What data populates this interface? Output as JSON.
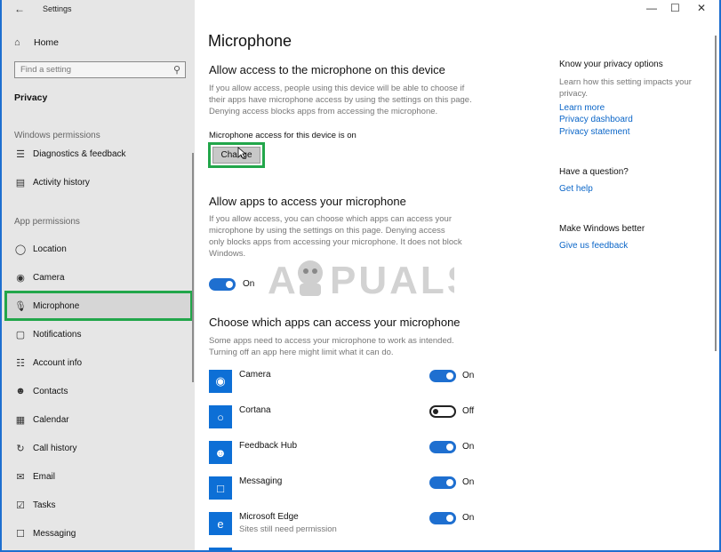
{
  "app": {
    "title": "Settings"
  },
  "nav": {
    "home_label": "Home",
    "search_placeholder": "Find a setting",
    "privacy_heading": "Privacy",
    "windows_permissions_label": "Windows permissions",
    "app_permissions_label": "App permissions",
    "items": [
      {
        "label": "Diagnostics & feedback",
        "icon": "diagnostics-icon"
      },
      {
        "label": "Activity history",
        "icon": "activity-history-icon"
      },
      {
        "label": "Location",
        "icon": "location-icon"
      },
      {
        "label": "Camera",
        "icon": "camera-icon"
      },
      {
        "label": "Microphone",
        "icon": "microphone-icon",
        "selected": true
      },
      {
        "label": "Notifications",
        "icon": "notifications-icon"
      },
      {
        "label": "Account info",
        "icon": "account-info-icon"
      },
      {
        "label": "Contacts",
        "icon": "contacts-icon"
      },
      {
        "label": "Calendar",
        "icon": "calendar-icon"
      },
      {
        "label": "Call history",
        "icon": "call-history-icon"
      },
      {
        "label": "Email",
        "icon": "email-icon"
      },
      {
        "label": "Tasks",
        "icon": "tasks-icon"
      },
      {
        "label": "Messaging",
        "icon": "messaging-icon"
      }
    ]
  },
  "main": {
    "page_title": "Microphone",
    "device_section": {
      "heading": "Allow access to the microphone on this device",
      "description": "If you allow access, people using this device will be able to choose if their apps have microphone access by using the settings on this page. Denying access blocks apps from accessing the microphone.",
      "status": "Microphone access for this device is on",
      "change_label": "Change"
    },
    "apps_section": {
      "heading": "Allow apps to access your microphone",
      "description": "If you allow access, you can choose which apps can access your microphone by using the settings on this page. Denying access only blocks apps from accessing your microphone. It does not block Windows.",
      "toggle_state": "On",
      "toggle_on": true
    },
    "choose_section": {
      "heading": "Choose which apps can access your microphone",
      "description": "Some apps need to access your microphone to work as intended. Turning off an app here might limit what it can do.",
      "apps": [
        {
          "name": "Camera",
          "subtitle": "",
          "state": "On",
          "on": true,
          "icon": "camera-app-icon"
        },
        {
          "name": "Cortana",
          "subtitle": "",
          "state": "Off",
          "on": false,
          "icon": "cortana-icon"
        },
        {
          "name": "Feedback Hub",
          "subtitle": "",
          "state": "On",
          "on": true,
          "icon": "feedback-hub-icon"
        },
        {
          "name": "Messaging",
          "subtitle": "",
          "state": "On",
          "on": true,
          "icon": "messaging-app-icon"
        },
        {
          "name": "Microsoft Edge",
          "subtitle": "Sites still need permission",
          "state": "On",
          "on": true,
          "icon": "edge-icon"
        }
      ]
    }
  },
  "side": {
    "privacy_heading": "Know your privacy options",
    "privacy_text": "Learn how this setting impacts your privacy.",
    "links": [
      "Learn more",
      "Privacy dashboard",
      "Privacy statement"
    ],
    "question_heading": "Have a question?",
    "get_help": "Get help",
    "better_heading": "Make Windows better",
    "feedback_link": "Give us feedback"
  },
  "watermark": {
    "text": "A PUALS"
  },
  "colors": {
    "accent": "#1e6fd0",
    "highlight": "#22a64a",
    "sidebar_bg": "#e6e6e6"
  }
}
